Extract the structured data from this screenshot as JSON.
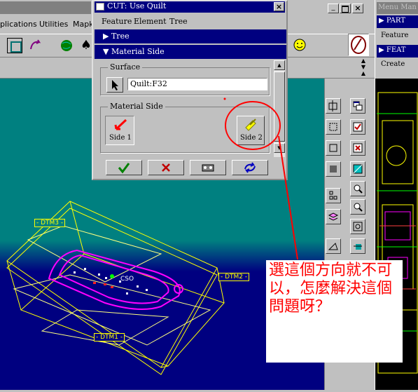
{
  "main_window": {
    "title": "",
    "menu": [
      "plications",
      "Utilities",
      "Mapk"
    ]
  },
  "menu_manager": {
    "title": "Menu Man",
    "items": [
      {
        "label": "PART",
        "type": "header"
      },
      {
        "label": "Feature",
        "type": "plain"
      },
      {
        "label": "FEAT",
        "type": "header"
      },
      {
        "label": "Create",
        "type": "plain"
      }
    ]
  },
  "dialog": {
    "title": "CUT: Use Quilt",
    "menu": [
      "Feature",
      "Element",
      "Tree"
    ],
    "tree_label": "Tree",
    "material_side_header": "Material Side",
    "surface_group_label": "Surface",
    "surface_value": "Quilt:F32",
    "material_group_label": "Material Side",
    "side1_label": "Side 1",
    "side2_label": "Side 2"
  },
  "model_labels": {
    "dtm1": "DTM1",
    "dtm2": "DTM2",
    "dtm3": "DTM3",
    "part_text": "CSO"
  },
  "annotation": {
    "text": "選這個方向就不可以，怎麼解決這個問題呀？"
  },
  "colors": {
    "viewport_top": "#008080",
    "viewport_bottom": "#000080",
    "title_bar": "#000080",
    "annotation_red": "#ff0000",
    "datum_yellow": "#ffff00",
    "part_magenta": "#ff00ff"
  }
}
